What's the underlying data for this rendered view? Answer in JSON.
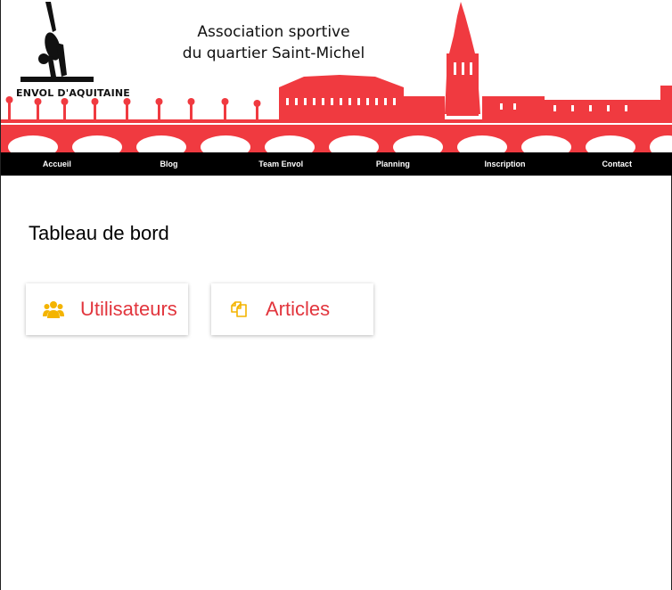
{
  "header": {
    "logo_text": "ENVOL D'AQUITAINE",
    "title_line1": "Association sportive",
    "title_line2": "du quartier Saint-Michel"
  },
  "nav": {
    "items": [
      {
        "label": "Accueil"
      },
      {
        "label": "Blog"
      },
      {
        "label": "Team Envol"
      },
      {
        "label": "Planning"
      },
      {
        "label": "Inscription"
      },
      {
        "label": "Contact"
      }
    ]
  },
  "main": {
    "title": "Tableau de bord",
    "cards": [
      {
        "label": "Utilisateurs",
        "icon": "users-icon"
      },
      {
        "label": "Articles",
        "icon": "copy-icon"
      }
    ]
  },
  "colors": {
    "accent_red": "#e2353d",
    "banner_red": "#f03a40",
    "icon_yellow": "#f4b400",
    "nav_bg": "#000000"
  }
}
